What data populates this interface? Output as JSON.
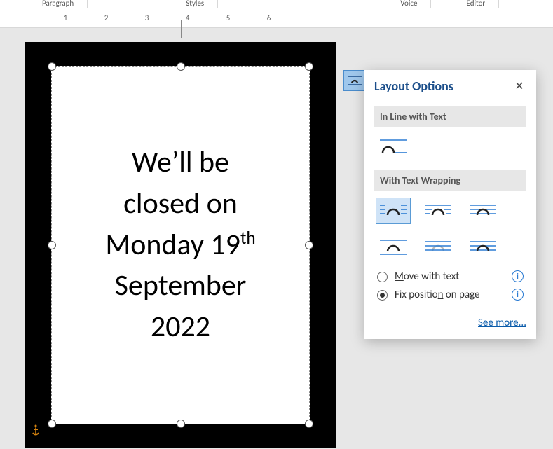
{
  "ribbon": {
    "groups": [
      "Paragraph",
      "Styles",
      "Voice",
      "Editor"
    ]
  },
  "ruler": {
    "marks": [
      "",
      "1",
      "",
      "2",
      "",
      "3",
      "",
      "4",
      "",
      "5",
      "",
      "6",
      "",
      ""
    ]
  },
  "document": {
    "line1": "We’ll be",
    "line2": "closed on",
    "line3_pre": "Monday 19",
    "line3_sup": "th",
    "line4": "September",
    "line5": "2022"
  },
  "layout_panel": {
    "title": "Layout Options",
    "section_inline": "In Line with Text",
    "section_wrap": "With Text Wrapping",
    "radio_move": "Move with text",
    "radio_fix": "Fix position on page",
    "see_more": "See more..."
  },
  "icons": {
    "close": "✕",
    "info": "i",
    "anchor": "⚓"
  }
}
